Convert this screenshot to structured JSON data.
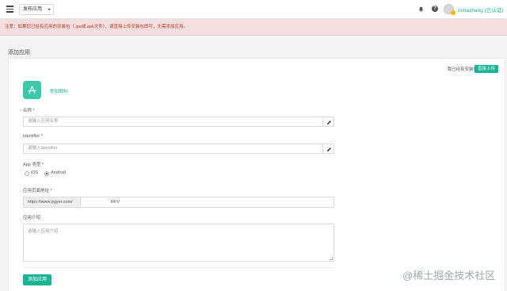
{
  "topbar": {
    "publish_label": "发布应用",
    "username": "richazhang (已认证)"
  },
  "alert": {
    "text": "注意：如果您已经有应用的安装包（.ipa或.apk文件），请直接上传安装包即可，无需添加应用。"
  },
  "page": {
    "title": "添加应用"
  },
  "form": {
    "have_package_text": "我已经有安装包",
    "direct_upload_label": "直接上传",
    "add_icon_label": "添加图标",
    "name": {
      "label": "名称 *",
      "placeholder": "请输入应用名称"
    },
    "identifier": {
      "label": "Identifier *",
      "placeholder": "请输入Identifier"
    },
    "app_type": {
      "label": "App 类型 *",
      "options": [
        {
          "label": "iOS",
          "selected": false
        },
        {
          "label": "Android",
          "selected": true
        }
      ]
    },
    "page_url": {
      "label": "应用页面地址 *",
      "prefix": "https://www.pgyer.com/",
      "value": "RFV"
    },
    "description": {
      "label": "应用介绍",
      "placeholder": "请输入应用介绍"
    },
    "submit_label": "添加应用"
  },
  "watermark": "@稀土掘金技术社区",
  "colors": {
    "accent": "#1ab394",
    "alert_bg": "#f2dede",
    "alert_text": "#c0392b"
  },
  "icons": [
    "menu-icon",
    "caret-down-icon",
    "bell-icon",
    "help-icon",
    "avatar",
    "app-store-icon",
    "pencil-icon"
  ]
}
